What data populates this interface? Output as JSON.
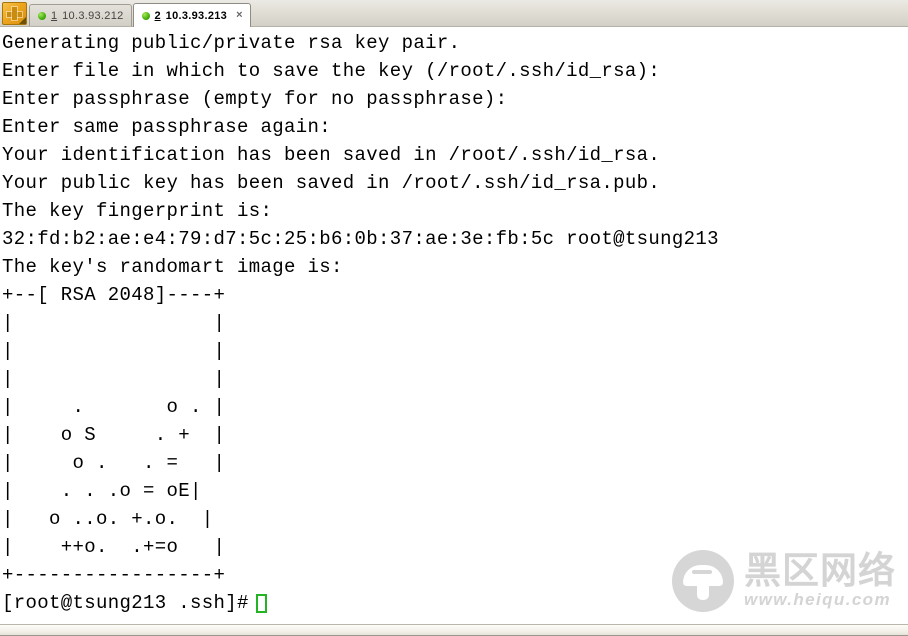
{
  "window": {
    "new_tab_button_label": "+",
    "tabs": [
      {
        "number": "1",
        "label": "10.3.93.212",
        "state": "inactive",
        "status_icon": "green-dot-icon"
      },
      {
        "number": "2",
        "label": "10.3.93.213",
        "state": "active",
        "status_icon": "green-dot-icon",
        "close_label": "×"
      }
    ]
  },
  "terminal": {
    "lines": [
      "Generating public/private rsa key pair.",
      "Enter file in which to save the key (/root/.ssh/id_rsa):",
      "Enter passphrase (empty for no passphrase):",
      "Enter same passphrase again:",
      "Your identification has been saved in /root/.ssh/id_rsa.",
      "Your public key has been saved in /root/.ssh/id_rsa.pub.",
      "The key fingerprint is:",
      "32:fd:b2:ae:e4:79:d7:5c:25:b6:0b:37:ae:3e:fb:5c root@tsung213",
      "The key's randomart image is:",
      "+--[ RSA 2048]----+",
      "|                 |",
      "|                 |",
      "|                 |",
      "|     .       o . |",
      "|    o S     . +  |",
      "|     o .   . =   |",
      "|    . . .o = oE|",
      "|   o ..o. +.o.  |",
      "|    ++o.  .+=o   |",
      "+-----------------+"
    ],
    "prompt": "[root@tsung213 .ssh]#",
    "cursor": "block-cursor",
    "cursor_color": "#22b422",
    "foreground_color": "#000000",
    "background_color": "#ffffff"
  },
  "watermark": {
    "logo_icon": "mushroom-logo-icon",
    "brand_cn": "黑区网络",
    "brand_url": "www.heiqu.com",
    "color": "#cdcdcd"
  }
}
